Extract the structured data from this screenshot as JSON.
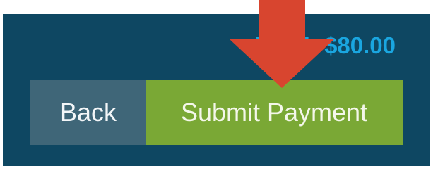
{
  "checkout": {
    "total_text": "Total: $80.00",
    "back_label": "Back",
    "submit_label": "Submit Payment"
  },
  "icons": {
    "pointer": "down-arrow-icon"
  },
  "colors": {
    "panel_bg": "#0e4762",
    "total_text": "#1aa6e0",
    "back_button_bg": "#3f6678",
    "submit_button_bg": "#7aa835",
    "arrow": "#d8452f"
  }
}
